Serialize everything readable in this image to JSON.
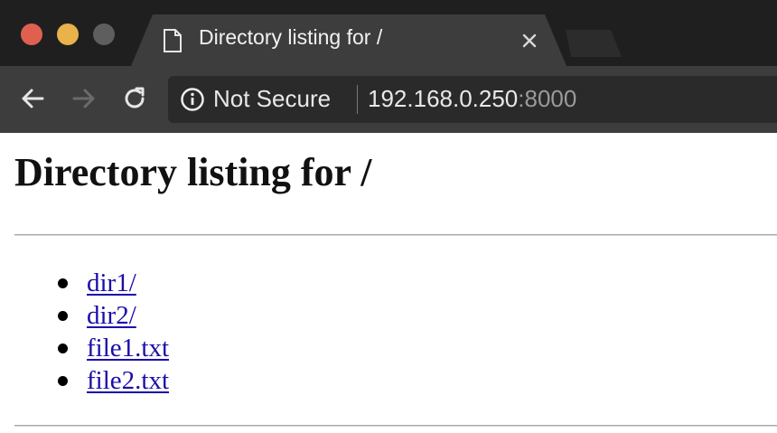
{
  "browser": {
    "tab": {
      "title": "Directory listing for /",
      "icon": "document-icon",
      "close_icon": "close-icon"
    },
    "toolbar": {
      "back_icon": "back-arrow-icon",
      "forward_icon": "forward-arrow-icon",
      "reload_icon": "reload-icon"
    },
    "address_bar": {
      "security_icon": "info-icon",
      "security_label": "Not Secure",
      "url_host": "192.168.0.250",
      "url_port": ":8000"
    }
  },
  "page": {
    "title": "Directory listing for /",
    "entries": [
      {
        "label": "dir1/"
      },
      {
        "label": "dir2/"
      },
      {
        "label": "file1.txt"
      },
      {
        "label": "file2.txt"
      }
    ]
  },
  "colors": {
    "tabstrip_bg": "#1f1f1f",
    "toolbar_bg": "#3d3d3d",
    "link": "#1a0dab",
    "close_button": "#e0604f",
    "minimize_button": "#e9b24a",
    "zoom_button": "#5e5e5e"
  }
}
